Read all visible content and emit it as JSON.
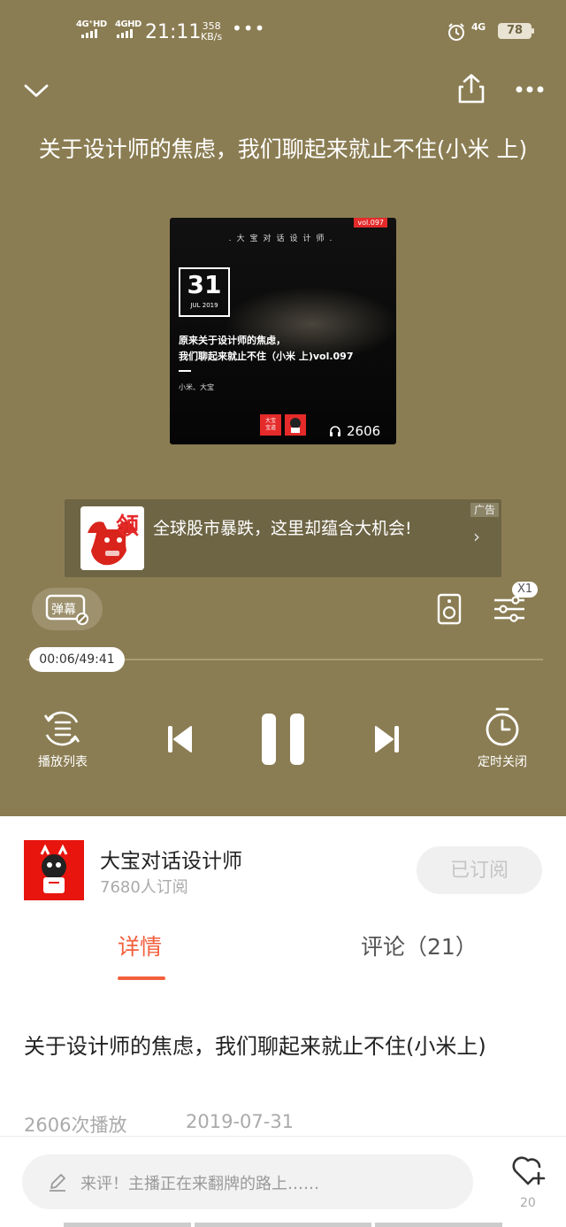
{
  "status_bar": {
    "net1": "4G⁺HD",
    "net2": "4GHD",
    "time": "21:11",
    "speed_value": "358",
    "speed_unit": "KB/s",
    "net3": "4G",
    "battery": "78"
  },
  "player": {
    "title": "关于设计师的焦虑，我们聊起来就止不住(小米 上)",
    "background_color": "#8b7d53",
    "cover": {
      "top_text": ".大宝对话设计师.",
      "vol": "vol.097",
      "day": "31",
      "month_year": "JUL 2019",
      "line1": "原来关于设计师的焦虑，",
      "line2": "我们聊起来就止不住（小米 上)vol.097",
      "authors": "小米、大宝",
      "logo_text": "大宝\n宝道",
      "plays": "2606"
    },
    "ad": {
      "badge": "广告",
      "text": "全球股市暴跌，这里却蕴含大机会!",
      "image_char": "领",
      "arrow": "›"
    },
    "danmu_label": "弹幕",
    "speed_label": "X1",
    "progress": {
      "current": "00:06",
      "total": "49:41",
      "display": "00:06/49:41",
      "fraction": 0.002
    },
    "controls": {
      "playlist_label": "播放列表",
      "timer_label": "定时关闭"
    }
  },
  "channel": {
    "name": "大宝对话设计师",
    "subscribers": "7680人订阅",
    "subscribe_button": "已订阅"
  },
  "tabs": {
    "detail": "详情",
    "comments": "评论（21）"
  },
  "episode": {
    "title": "关于设计师的焦虑，我们聊起来就止不住(小米上)",
    "plays": "2606次播放",
    "date": "2019-07-31"
  },
  "bottom": {
    "comment_placeholder": "来评！主播正在来翻牌的路上……",
    "like_count": "20"
  },
  "colors": {
    "accent": "#f3603d",
    "brand_red": "#e8150e"
  }
}
